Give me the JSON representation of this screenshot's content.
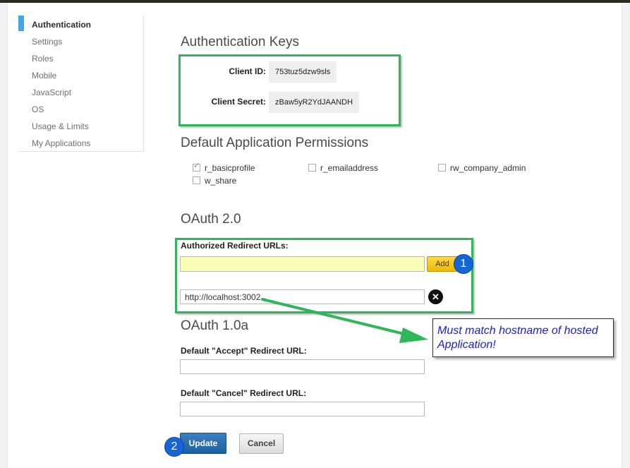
{
  "sidebar": {
    "items": [
      {
        "label": "Authentication",
        "active": true
      },
      {
        "label": "Settings"
      },
      {
        "label": "Roles"
      },
      {
        "label": "Mobile"
      },
      {
        "label": "JavaScript"
      },
      {
        "label": "OS"
      },
      {
        "label": "Usage & Limits"
      },
      {
        "label": "My Applications"
      }
    ]
  },
  "auth_keys": {
    "heading": "Authentication Keys",
    "client_id_label": "Client ID:",
    "client_id_value": "753tuz5dzw9sls",
    "client_secret_label": "Client Secret:",
    "client_secret_value": "zBaw5yR2YdJAANDH"
  },
  "permissions": {
    "heading": "Default Application Permissions",
    "items": [
      {
        "label": "r_basicprofile",
        "checked": true
      },
      {
        "label": "r_emailaddress",
        "checked": false
      },
      {
        "label": "rw_company_admin",
        "checked": false
      },
      {
        "label": "w_share",
        "checked": false
      }
    ]
  },
  "oauth2": {
    "heading": "OAuth 2.0",
    "redirect_label": "Authorized Redirect URLs:",
    "new_url_value": "",
    "add_label": "Add",
    "existing_url": "http://localhost:3002",
    "remove_icon": "close-icon"
  },
  "oauth1": {
    "heading": "OAuth 1.0a",
    "accept_label": "Default \"Accept\" Redirect URL:",
    "accept_value": "",
    "cancel_label": "Default \"Cancel\" Redirect URL:",
    "cancel_value": ""
  },
  "actions": {
    "update_label": "Update",
    "cancel_label": "Cancel"
  },
  "annotations": {
    "badge_1": "1",
    "badge_2": "2",
    "note_text": "Must match hostname of hosted Application!",
    "highlight_color": "#2fb65a",
    "badge_color": "#1565d4",
    "note_text_color": "#1a1ad8"
  }
}
